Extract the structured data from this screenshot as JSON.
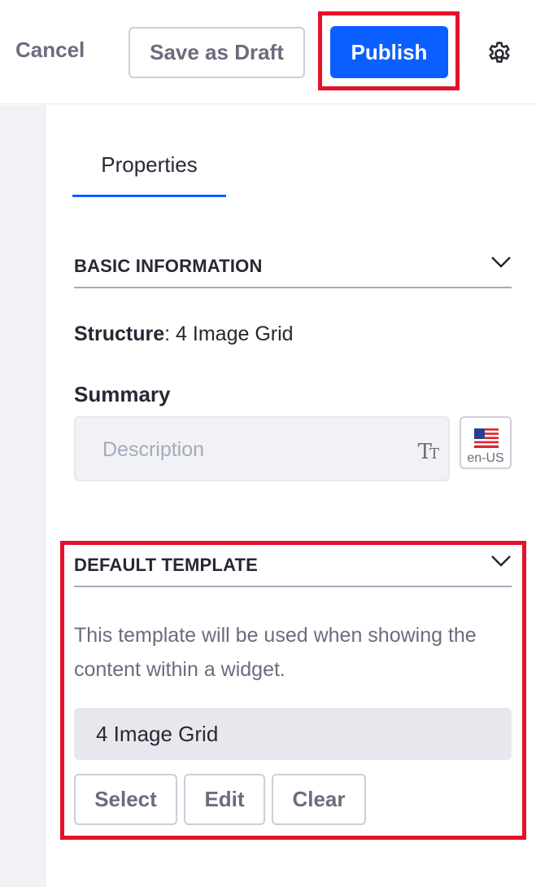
{
  "toolbar": {
    "cancel_label": "Cancel",
    "save_draft_label": "Save as Draft",
    "publish_label": "Publish",
    "settings_icon": "gear-icon"
  },
  "tabs": [
    {
      "label": "Properties",
      "active": true
    }
  ],
  "basic_information": {
    "title": "BASIC INFORMATION",
    "structure_label": "Structure",
    "structure_value": "4 Image Grid",
    "summary_label": "Summary",
    "summary_placeholder": "Description",
    "locale_label": "en-US"
  },
  "default_template": {
    "title": "DEFAULT TEMPLATE",
    "description": "This template will be used when showing the content within a widget.",
    "selected_template": "4 Image Grid",
    "select_label": "Select",
    "edit_label": "Edit",
    "clear_label": "Clear"
  },
  "colors": {
    "primary": "#0b5fff",
    "highlight": "#e5112a",
    "secondary_text": "#6b6c7e"
  }
}
